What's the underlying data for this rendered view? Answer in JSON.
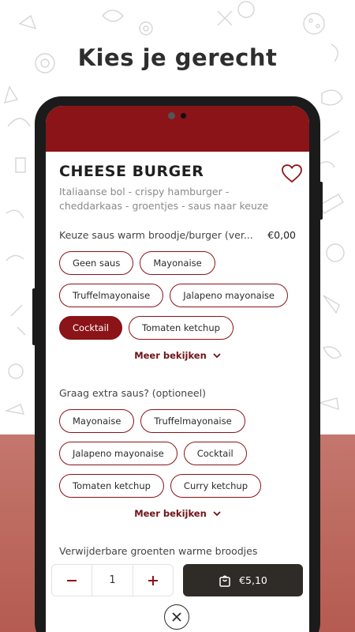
{
  "headline": "Kies je gerecht",
  "product": {
    "title": "CHEESE BURGER",
    "description": "Italiaanse bol - crispy hamburger - cheddarkaas - groentjes - saus naar keuze"
  },
  "sections": [
    {
      "title": "Keuze saus warm broodje/burger (ver...",
      "price": "€0,00",
      "options": [
        {
          "label": "Geen saus",
          "selected": false
        },
        {
          "label": "Mayonaise",
          "selected": false
        },
        {
          "label": "Truffelmayonaise",
          "selected": false
        },
        {
          "label": "Jalapeno mayonaise",
          "selected": false
        },
        {
          "label": "Cocktail",
          "selected": true
        },
        {
          "label": "Tomaten ketchup",
          "selected": false
        }
      ],
      "more_label": "Meer bekijken"
    },
    {
      "title": "Graag extra saus? (optioneel)",
      "options": [
        {
          "label": "Mayonaise",
          "selected": false
        },
        {
          "label": "Truffelmayonaise",
          "selected": false
        },
        {
          "label": "Jalapeno mayonaise",
          "selected": false
        },
        {
          "label": "Cocktail",
          "selected": false
        },
        {
          "label": "Tomaten ketchup",
          "selected": false
        },
        {
          "label": "Curry ketchup",
          "selected": false
        }
      ],
      "more_label": "Meer bekijken"
    },
    {
      "title": "Verwijderbare groenten warme broodjes"
    }
  ],
  "quantity": {
    "value": "1",
    "minus_icon": "minus-icon",
    "plus_icon": "plus-icon"
  },
  "cart": {
    "price": "€5,10",
    "icon": "shopping-bag-icon"
  },
  "close_icon": "close-icon",
  "colors": {
    "brand": "#8a1418",
    "cart_button": "#2f2b27",
    "band": "#b55b51"
  }
}
